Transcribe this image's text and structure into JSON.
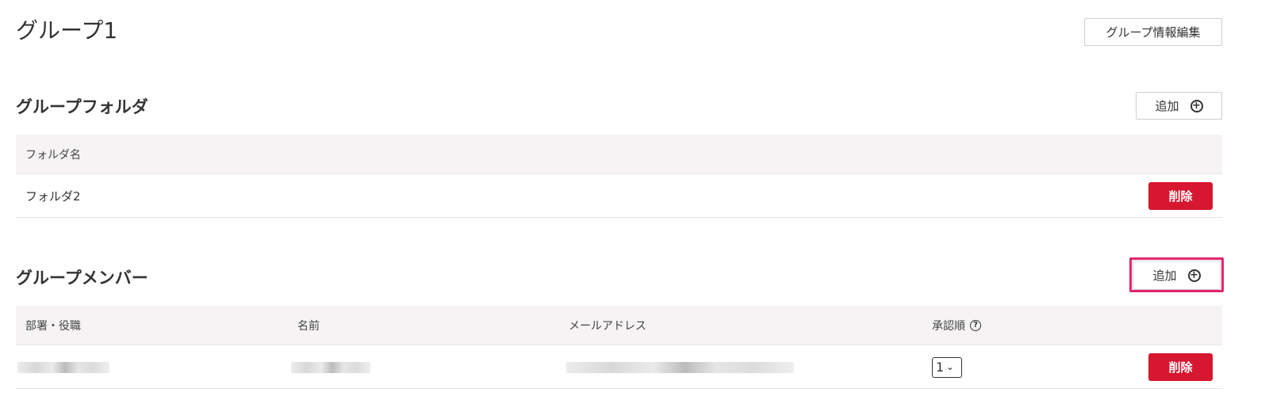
{
  "header": {
    "title": "グループ1",
    "edit_button": "グループ情報編集"
  },
  "folders": {
    "title": "グループフォルダ",
    "add_button": "追加",
    "add_icon": "plus-circle-icon",
    "columns": [
      "フォルダ名"
    ],
    "rows": [
      {
        "name": "フォルダ2",
        "delete_label": "削除"
      }
    ]
  },
  "members": {
    "title": "グループメンバー",
    "add_button": "追加",
    "add_icon": "plus-circle-icon",
    "highlight_color": "#e0246e",
    "columns": {
      "department": "部署・役職",
      "name": "名前",
      "email": "メールアドレス",
      "approval_order": "承認順",
      "approval_help_icon": "question-circle-icon"
    },
    "rows": [
      {
        "approval_order": "1",
        "delete_label": "削除"
      }
    ]
  },
  "colors": {
    "delete": "#d7162f",
    "table_header_bg": "#f5f3f3"
  }
}
